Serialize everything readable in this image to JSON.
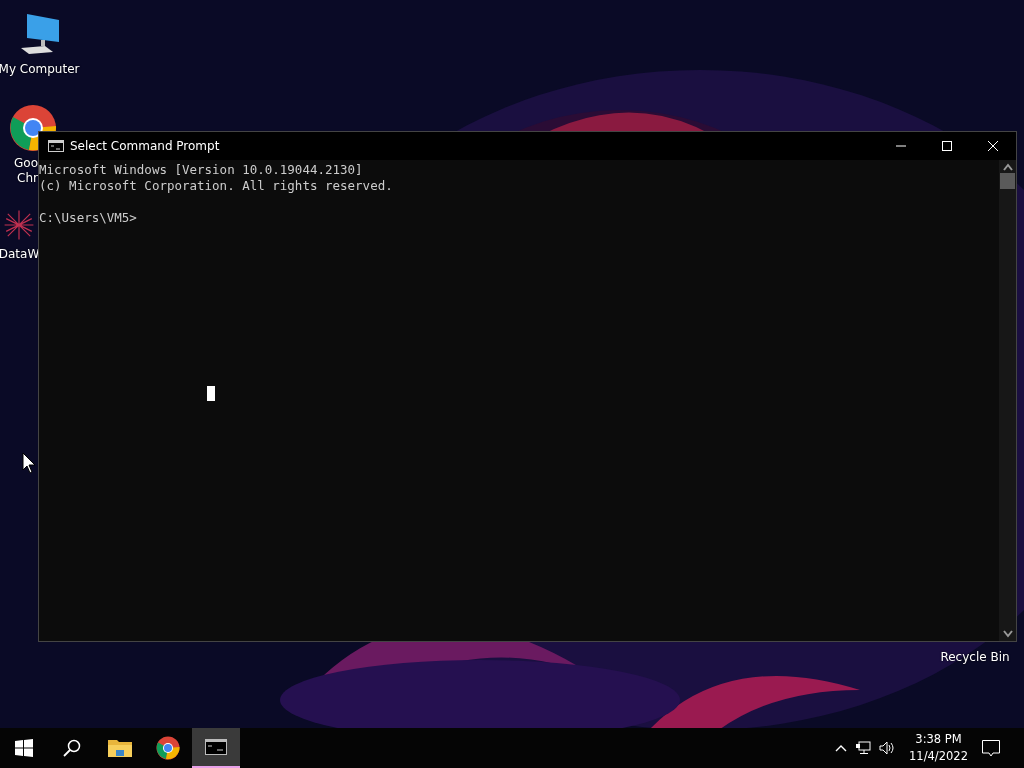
{
  "desktop_icons": [
    {
      "kind": "computer",
      "lines": [
        "My Computer"
      ]
    },
    {
      "kind": "chrome",
      "lines": [
        "Goo",
        "Chr"
      ]
    },
    {
      "kind": "datawrapper",
      "lines": [
        "DataW"
      ]
    },
    {
      "kind": "recycle",
      "lines": [
        "Recycle Bin"
      ]
    }
  ],
  "window": {
    "title": "Select Command Prompt",
    "output": [
      "Microsoft Windows [Version 10.0.19044.2130]",
      "(c) Microsoft Corporation. All rights reserved."
    ],
    "prompt": "C:\\Users\\VM5>"
  },
  "taskbar": {
    "items": [
      {
        "kind": "start",
        "active": false
      },
      {
        "kind": "search",
        "active": false
      },
      {
        "kind": "explorer",
        "active": false
      },
      {
        "kind": "chrome",
        "active": false
      },
      {
        "kind": "cmd",
        "active": true
      }
    ],
    "clock": {
      "time": "3:38 PM",
      "date": "11/4/2022"
    }
  }
}
